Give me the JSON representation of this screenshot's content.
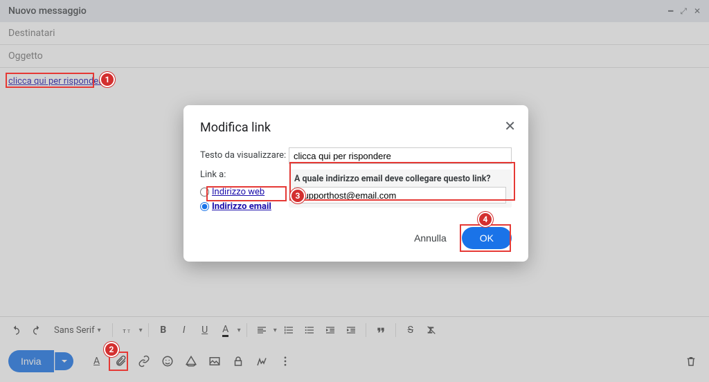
{
  "compose": {
    "title": "Nuovo messaggio",
    "recipients_placeholder": "Destinatari",
    "subject_placeholder": "Oggetto",
    "body_link_text": "clicca qui per rispondere"
  },
  "format_bar": {
    "font_family": "Sans Serif"
  },
  "action_bar": {
    "send_label": "Invia"
  },
  "dialog": {
    "title": "Modifica link",
    "display_text_label": "Testo da visualizzare:",
    "display_text_value": "clicca qui per rispondere",
    "link_to_label": "Link a:",
    "radio_web_label": "Indirizzo web",
    "radio_email_label": "Indirizzo email",
    "email_question": "A quale indirizzo email deve collegare questo link?",
    "email_value": "supporthost@email.com",
    "cancel_label": "Annulla",
    "ok_label": "OK"
  },
  "annotations": {
    "n1": "1",
    "n2": "2",
    "n3": "3",
    "n4": "4"
  }
}
